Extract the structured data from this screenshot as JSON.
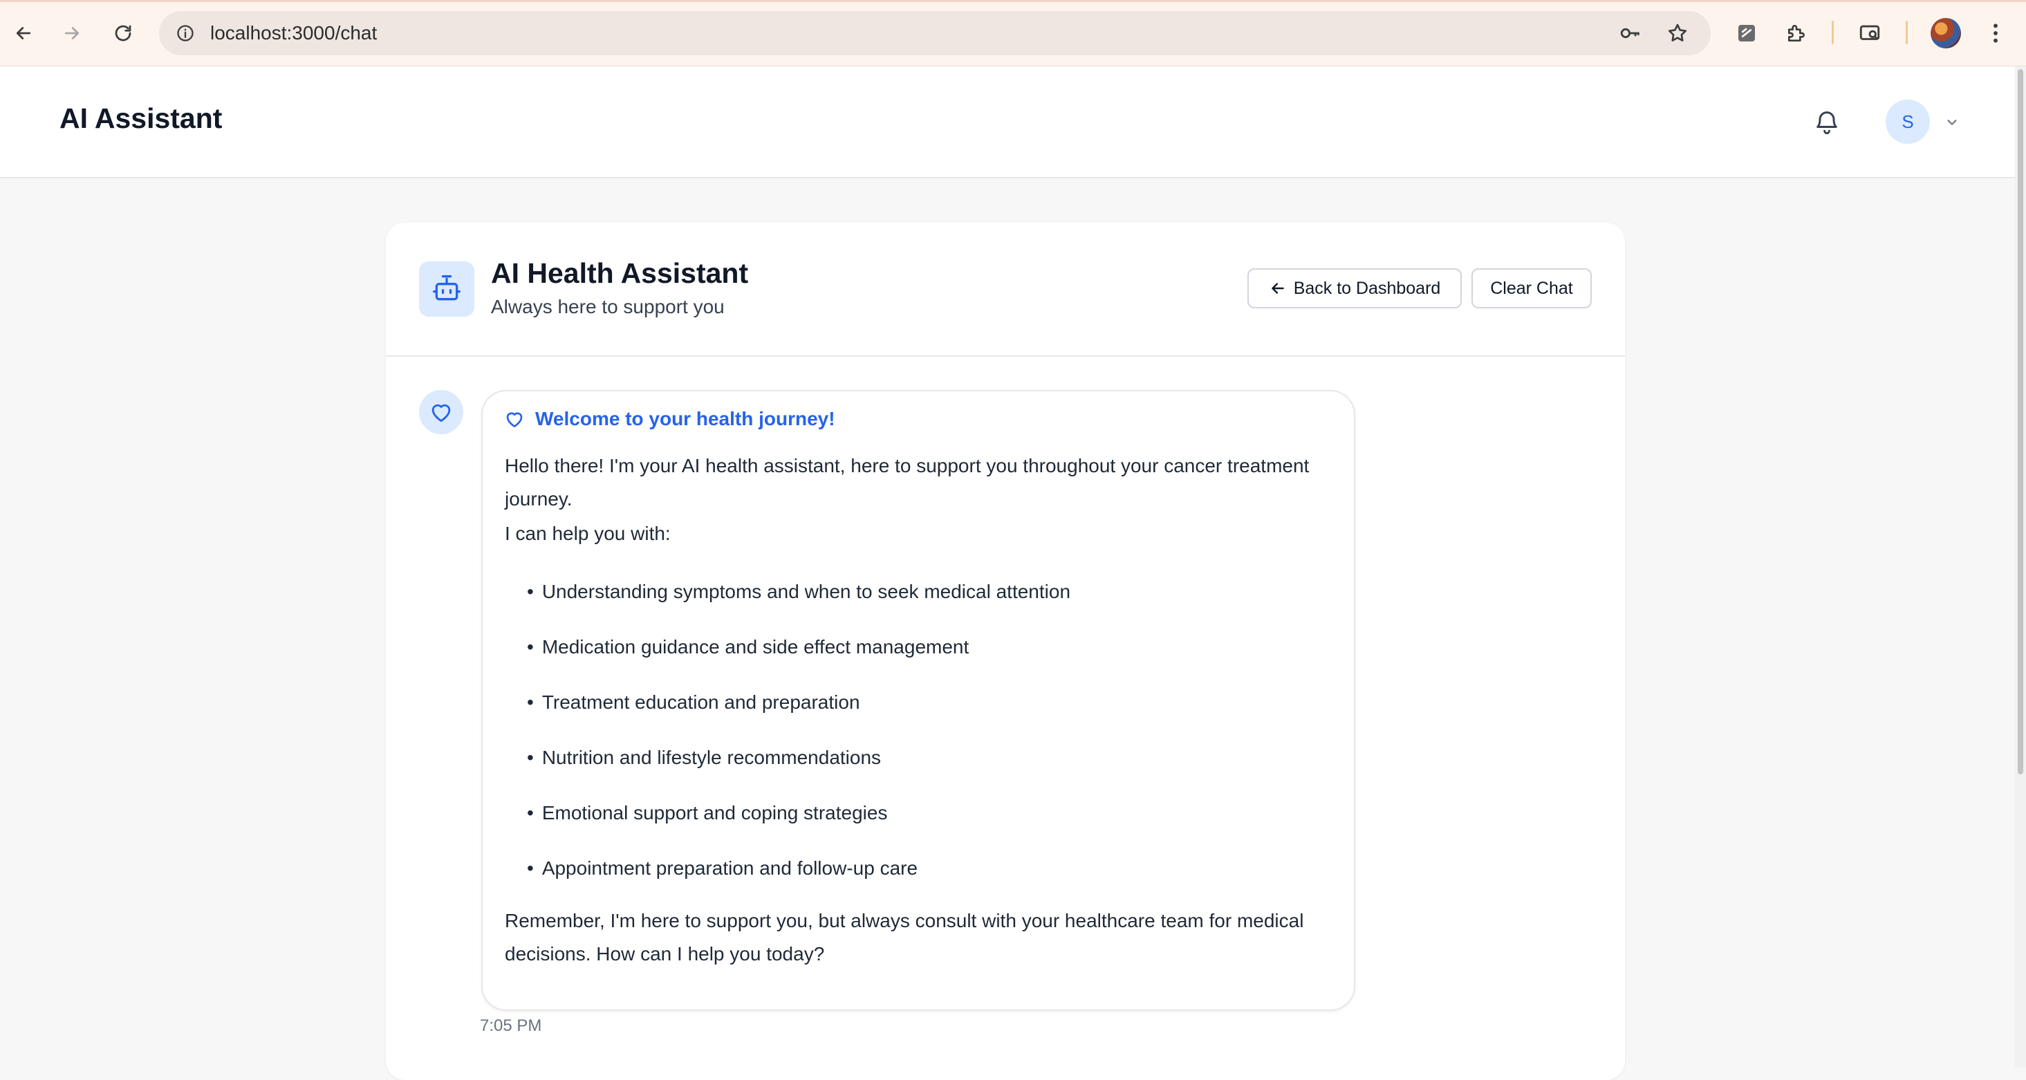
{
  "browser": {
    "url": "localhost:3000/chat"
  },
  "header": {
    "title": "AI Assistant",
    "user_initial": "S"
  },
  "chat": {
    "title": "AI Health Assistant",
    "subtitle": "Always here to support you",
    "back_label": "Back to Dashboard",
    "clear_label": "Clear Chat",
    "message": {
      "heading": "Welcome to your health journey!",
      "intro": "Hello there! I'm your AI health assistant, here to support you throughout your cancer treatment journey.",
      "lead": "I can help you with:",
      "items": [
        "Understanding symptoms and when to seek medical attention",
        "Medication guidance and side effect management",
        "Treatment education and preparation",
        "Nutrition and lifestyle recommendations",
        "Emotional support and coping strategies",
        "Appointment preparation and follow-up care"
      ],
      "closing": "Remember, I'm here to support you, but always consult with your healthcare team for medical decisions. How can I help you today?",
      "time": "7:05 PM"
    }
  },
  "colors": {
    "accent": "#2563eb",
    "accent_soft": "#dbeafe",
    "page_bg": "#f7f7f8"
  }
}
